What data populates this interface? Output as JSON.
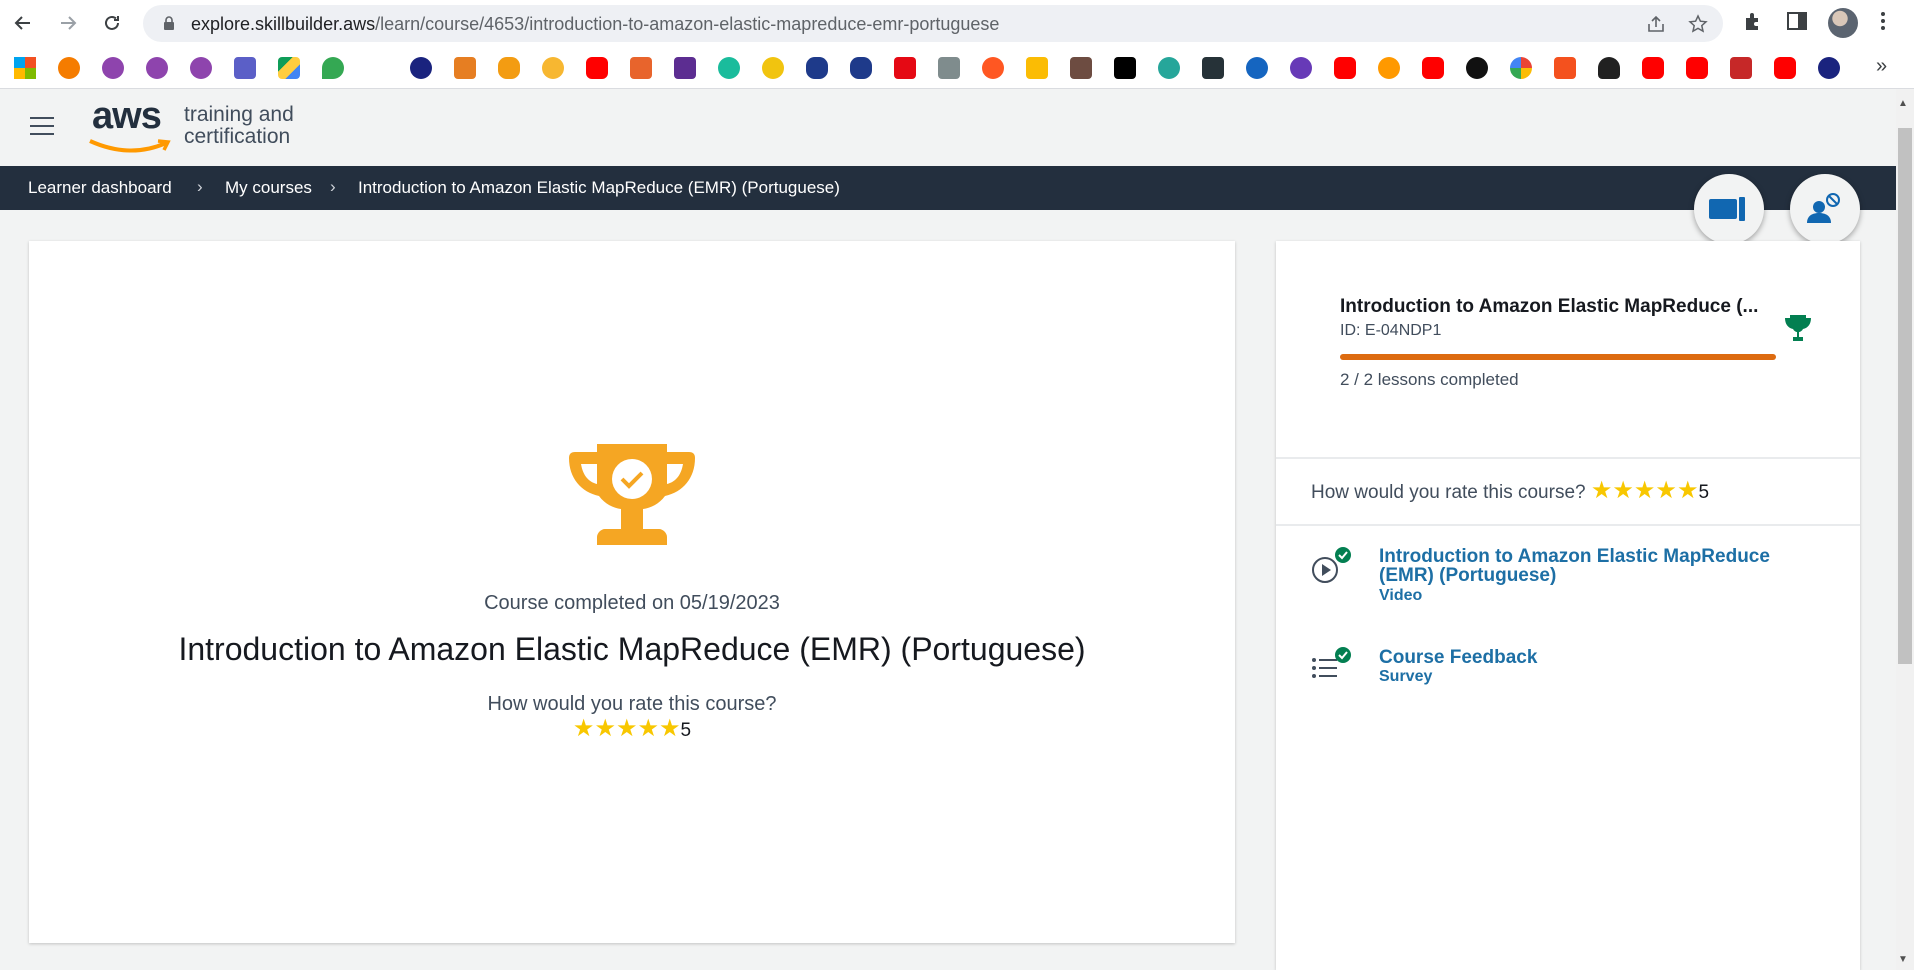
{
  "browser": {
    "url_host": "explore.skillbuilder.aws",
    "url_path": "/learn/course/4653/introduction-to-amazon-elastic-mapreduce-emr-portuguese",
    "back_icon": "arrow-left-icon",
    "forward_icon": "arrow-right-icon",
    "reload_icon": "reload-icon",
    "overflow_label": "»"
  },
  "header": {
    "logo_text": "aws",
    "tagline_line1": "training and",
    "tagline_line2": "certification"
  },
  "breadcrumb": {
    "items": [
      "Learner dashboard",
      "My courses",
      "Introduction to Amazon Elastic MapReduce (EMR) (Portuguese)"
    ],
    "separator": "›"
  },
  "main": {
    "completed_text": "Course completed on 05/19/2023",
    "title": "Introduction to Amazon Elastic MapReduce (EMR) (Portuguese)",
    "rate_question": "How would you rate this course?",
    "rating_value": "5",
    "rating_stars": 5
  },
  "side": {
    "title": "Introduction to Amazon Elastic MapReduce (...",
    "id_text": "ID: E-04NDP1",
    "progress_fraction": 1.0,
    "lessons_text": "2 / 2 lessons completed",
    "rate_question": "How would you rate this course?",
    "rating_value": "5",
    "lessons": [
      {
        "title": "Introduction to Amazon Elastic MapReduce (EMR) (Portuguese)",
        "type": "Video",
        "icon": "play-circle-icon",
        "status": "completed"
      },
      {
        "title": "Course Feedback",
        "type": "Survey",
        "icon": "list-icon",
        "status": "completed"
      }
    ]
  },
  "colors": {
    "accent": "#dd6b10",
    "trophy": "#f5a623",
    "nav_bg": "#232f3e",
    "link": "#1d6fa5",
    "success": "#037f51",
    "star": "#f8c700"
  }
}
